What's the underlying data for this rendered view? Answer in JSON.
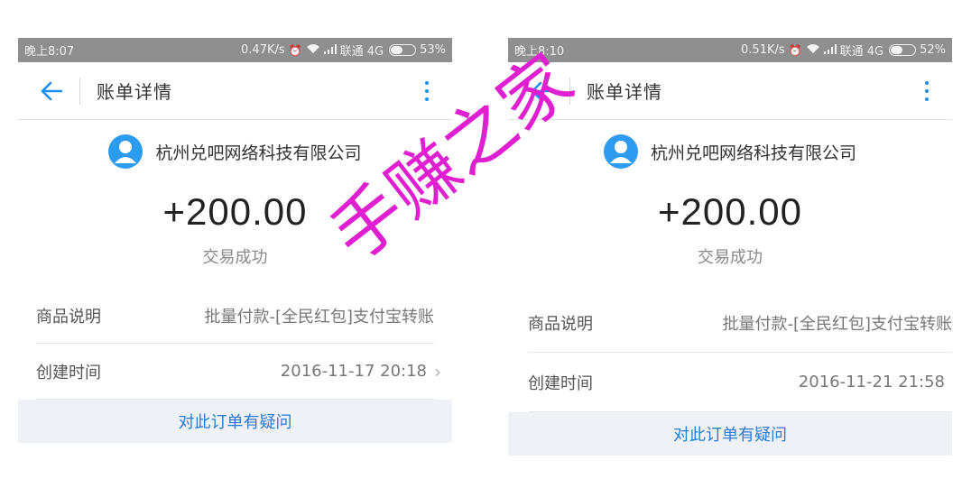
{
  "phones": [
    {
      "status_bar": {
        "time": "晚上8:07",
        "net_speed": "0.47K/s",
        "carrier": "联通 4G",
        "battery_percent": "53%",
        "battery_level": 0.53
      },
      "nav": {
        "title": "账单详情"
      },
      "merchant": {
        "name": "杭州兑吧网络科技有限公司"
      },
      "amount": "+200.00",
      "status": "交易成功",
      "details": [
        {
          "label": "商品说明",
          "value": "批量付款-[全民红包]支付宝转账",
          "has_arrow": false
        },
        {
          "label": "创建时间",
          "value": "2016-11-17 20:18",
          "has_arrow": true
        }
      ],
      "question_button": "对此订单有疑问"
    },
    {
      "status_bar": {
        "time": "晚上8:10",
        "net_speed": "0.51K/s",
        "carrier": "联通 4G",
        "battery_percent": "52%",
        "battery_level": 0.52
      },
      "nav": {
        "title": "账单详情"
      },
      "merchant": {
        "name": "杭州兑吧网络科技有限公司"
      },
      "amount": "+200.00",
      "status": "交易成功",
      "details": [
        {
          "label": "商品说明",
          "value": "批量付款-[全民红包]支付宝转账",
          "has_arrow": false
        },
        {
          "label": "创建时间",
          "value": "2016-11-21 21:58",
          "has_arrow": true
        }
      ],
      "question_button": "对此订单有疑问"
    }
  ],
  "watermark": {
    "text": "手赚之家",
    "color": "#e020d0"
  },
  "colors": {
    "accent": "#1a8ff1",
    "link": "#2c7ad6",
    "status_bar": "#8f8f8f"
  },
  "icons": [
    "back-arrow-icon",
    "more-vertical-icon",
    "user-avatar-icon",
    "chevron-right-icon",
    "alarm-icon",
    "wifi-icon",
    "signal-icon",
    "battery-icon"
  ]
}
